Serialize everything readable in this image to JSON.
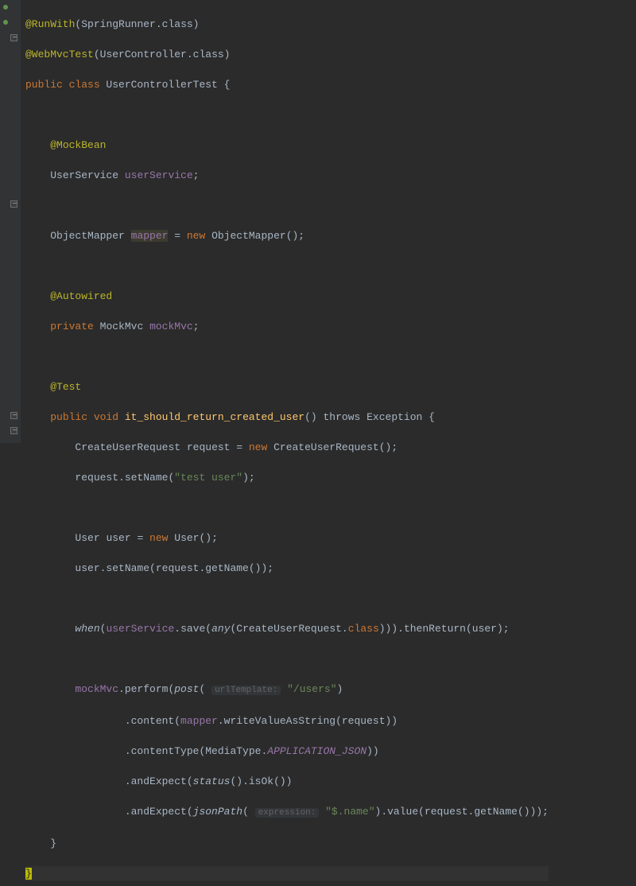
{
  "code": {
    "l1_ann": "@RunWith",
    "l1_arg": "SpringRunner",
    "l1_tail": ".class)",
    "l2_ann": "@WebMvcTest",
    "l2_arg": "UserController",
    "l2_tail": ".class)",
    "l3_mods": "public class ",
    "l3_cls": "UserControllerTest",
    "l3_brace": " {",
    "l5_ann": "@MockBean",
    "l6_type": "UserService ",
    "l6_var": "userService",
    "l6_semi": ";",
    "l8_type": "ObjectMapper ",
    "l8_var": "mapper",
    "l8_eq": " = ",
    "l8_new": "new ",
    "l8_ctor": "ObjectMapper();",
    "l10_ann": "@Autowired",
    "l11_mods": "private ",
    "l11_type": "MockMvc ",
    "l11_var": "mockMvc",
    "l11_semi": ";",
    "l13_ann": "@Test",
    "l14_mods": "public void ",
    "l14_mth": "it_should_return_created_user",
    "l14_throws": "() throws ",
    "l14_exc": "Exception ",
    "l14_brace": "{",
    "l15_type": "CreateUserRequest ",
    "l15_var": "request = ",
    "l15_new": "new ",
    "l15_ctor": "CreateUserRequest();",
    "l16_a": "request.setName(",
    "l16_str": "\"test user\"",
    "l16_b": ");",
    "l18_type": "User ",
    "l18_var": "user = ",
    "l18_new": "new ",
    "l18_ctor": "User();",
    "l19_a": "user.setName(request.getName());",
    "l21_when": "when",
    "l21_a": "(",
    "l21_svc": "userService",
    "l21_b": ".save(",
    "l21_any": "any",
    "l21_c": "(CreateUserRequest.",
    "l21_klass": "class",
    "l21_d": "))).thenReturn(user);",
    "l23_a": "mockMvc",
    "l23_b": ".perform(",
    "l23_post": "post",
    "l23_c": "( ",
    "l23_hint": "urlTemplate:",
    "l23_str": " \"/users\"",
    "l23_d": ")",
    "l24_a": ".content(",
    "l24_m": "mapper",
    "l24_b": ".writeValueAsString(request))",
    "l25_a": ".contentType(MediaType.",
    "l25_const": "APPLICATION_JSON",
    "l25_b": "))",
    "l26_a": ".andExpect(",
    "l26_st": "status",
    "l26_b": "().isOk())",
    "l27_a": ".andExpect(",
    "l27_jp": "jsonPath",
    "l27_b": "( ",
    "l27_hint": "expression:",
    "l27_str": " \"$.name\"",
    "l27_c": ").value(request.getName()));",
    "l28": "}",
    "l29": "}"
  }
}
